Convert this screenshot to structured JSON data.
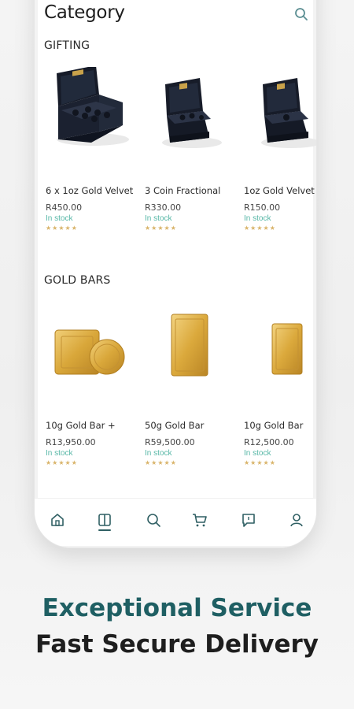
{
  "header": {
    "title": "Category"
  },
  "sections": [
    {
      "title": "GIFTING",
      "products": [
        {
          "name": "6 x 1oz Gold Velvet",
          "price": "R450.00",
          "stock": "In stock",
          "stars": "★★★★★"
        },
        {
          "name": "3 Coin Fractional",
          "price": "R330.00",
          "stock": "In stock",
          "stars": "★★★★★"
        },
        {
          "name": "1oz Gold Velvet",
          "price": "R150.00",
          "stock": "In stock",
          "stars": "★★★★★"
        }
      ]
    },
    {
      "title": "GOLD BARS",
      "products": [
        {
          "name": "10g Gold Bar +",
          "price": "R13,950.00",
          "stock": "In stock",
          "stars": "★★★★★"
        },
        {
          "name": "50g Gold Bar",
          "price": "R59,500.00",
          "stock": "In stock",
          "stars": "★★★★★"
        },
        {
          "name": "10g Gold Bar",
          "price": "R12,500.00",
          "stock": "In stock",
          "stars": "★★★★★"
        }
      ]
    }
  ],
  "bottom_nav": [
    {
      "icon": "home-icon",
      "active": false
    },
    {
      "icon": "category-icon",
      "active": true
    },
    {
      "icon": "search-icon",
      "active": false
    },
    {
      "icon": "cart-icon",
      "active": false
    },
    {
      "icon": "chat-icon",
      "active": false
    },
    {
      "icon": "account-icon",
      "active": false
    }
  ],
  "tagline": {
    "line1": "Exceptional Service",
    "line2": "Fast Secure Delivery"
  },
  "colors": {
    "accent": "#1f5f63",
    "stock": "#56b7a6",
    "stars": "#d9b46a",
    "gold": "#d9a73a"
  }
}
